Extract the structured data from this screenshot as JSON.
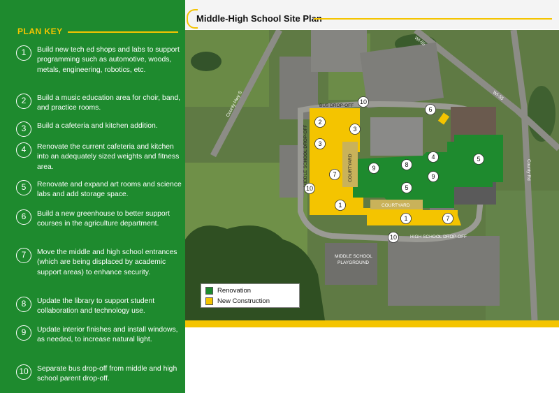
{
  "plan_key": {
    "heading": "PLAN KEY",
    "items": [
      {
        "num": "1",
        "text": "Build new tech ed shops and labs to support programming such as automotive, woods, metals, engineering, robotics, etc."
      },
      {
        "num": "2",
        "text": "Build a music education area for choir, band, and practice rooms."
      },
      {
        "num": "3",
        "text": "Build a cafeteria and kitchen addition."
      },
      {
        "num": "4",
        "text": "Renovate the current cafeteria and kitchen into an adequately sized weights and fitness area."
      },
      {
        "num": "5",
        "text": "Renovate and expand art rooms and science labs and add storage space."
      },
      {
        "num": "6",
        "text": "Build a new greenhouse to better support courses in the agriculture department."
      },
      {
        "num": "7",
        "text": "Move the middle and high school entrances (which are being displaced by academic support areas) to enhance security."
      },
      {
        "num": "8",
        "text": "Update the library to support student collaboration and technology use."
      },
      {
        "num": "9",
        "text": "Update interior finishes and install windows, as needed, to increase natural light."
      },
      {
        "num": "10",
        "text": "Separate bus drop-off from middle and high school parent drop-off."
      }
    ]
  },
  "map": {
    "title": "Middle-High School Site Plan",
    "labels": {
      "bus_dropoff": "BUS DROP-OFF",
      "ms_dropoff": "MIDDLE SCHOOL DROP-OFF",
      "hs_dropoff": "HIGH SCHOOL DROP-OFF",
      "courtyard_v": "COURTYARD",
      "courtyard_h": "COURTYARD",
      "playground_1": "MIDDLE SCHOOL",
      "playground_2": "PLAYGROUND",
      "county_hwy_s": "County Hwy S",
      "wi_55_a": "WI-55",
      "wi_55_b": "WI-55",
      "county_rd": "County Rd"
    },
    "markers": [
      "10",
      "6",
      "2",
      "3",
      "3",
      "4",
      "5",
      "9",
      "8",
      "9",
      "7",
      "10",
      "5",
      "1",
      "1",
      "7",
      "10"
    ],
    "legend": {
      "renovation": "Renovation",
      "new_construction": "New Construction",
      "renovation_color": "#1e8a2e",
      "new_construction_color": "#f4c400"
    }
  }
}
